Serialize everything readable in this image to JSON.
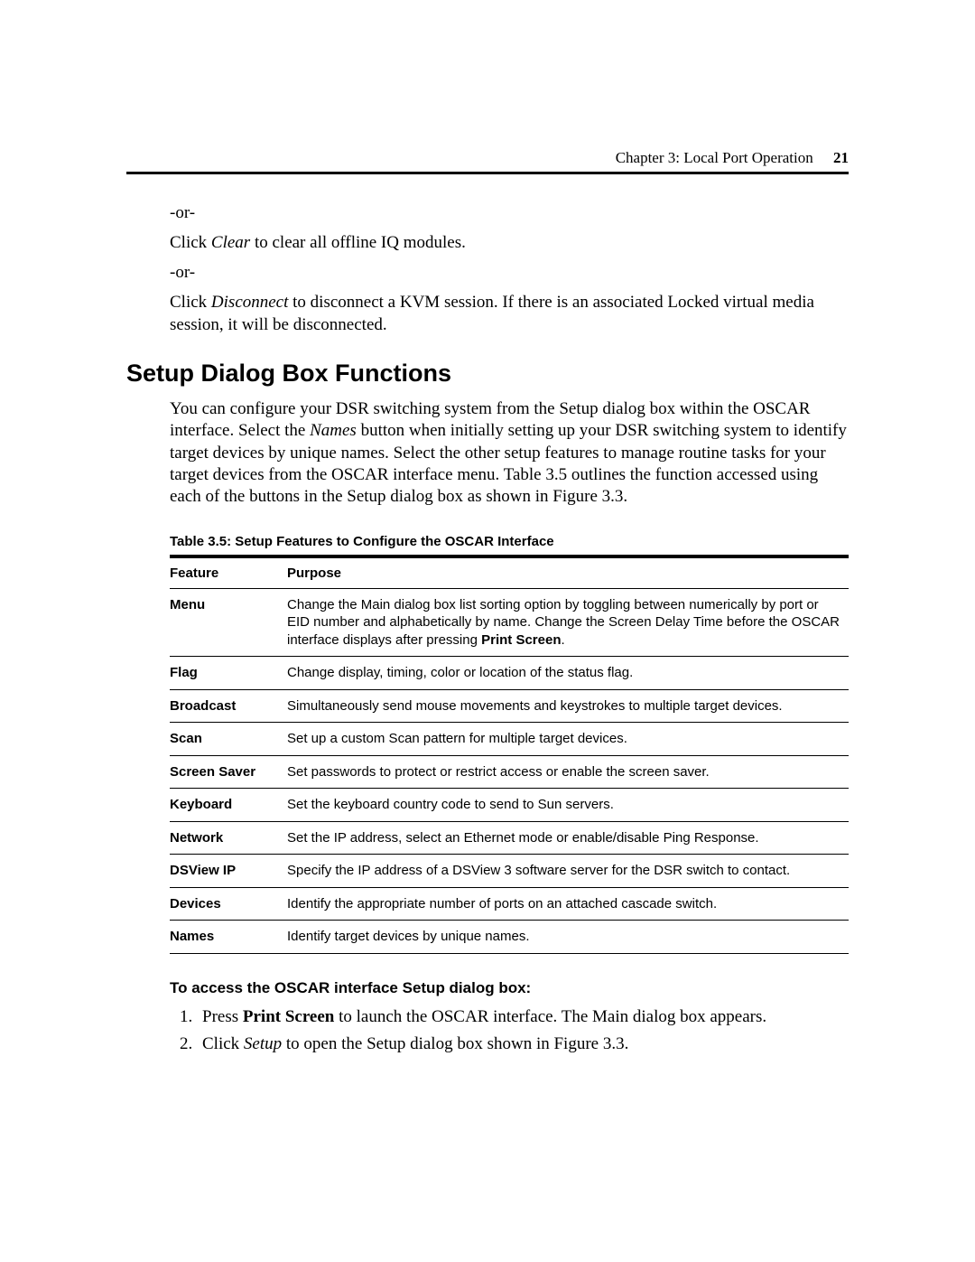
{
  "header": {
    "chapter_label": "Chapter 3: Local Port Operation",
    "page_number": "21"
  },
  "intro": {
    "or1": "-or-",
    "p1_before": "Click ",
    "p1_em": "Clear",
    "p1_after": " to clear all offline IQ modules.",
    "or2": "-or-",
    "p2_before": "Click ",
    "p2_em": "Disconnect",
    "p2_after": " to disconnect a KVM session. If there is an associated Locked virtual media session, it will be disconnected."
  },
  "section_heading": "Setup Dialog Box Functions",
  "section_para": {
    "before": "You can configure your DSR switching system from the Setup dialog box within the OSCAR interface. Select the ",
    "em": "Names",
    "after": " button when initially setting up your DSR switching system to identify target devices by unique names. Select the other setup features to manage routine tasks for your target devices from the OSCAR interface menu. Table 3.5 outlines the function accessed using each of the buttons in the Setup dialog box as shown in Figure 3.3."
  },
  "table": {
    "caption": "Table 3.5: Setup Features to Configure the OSCAR Interface",
    "col_feature": "Feature",
    "col_purpose": "Purpose",
    "rows": [
      {
        "feature": "Menu",
        "purpose_before": "Change the Main dialog box list sorting option by toggling between numerically by port or EID number and alphabetically by name. Change the Screen Delay Time before the OSCAR interface displays after pressing ",
        "purpose_bold": "Print Screen",
        "purpose_after": "."
      },
      {
        "feature": "Flag",
        "purpose": "Change display, timing, color or location of the status flag."
      },
      {
        "feature": "Broadcast",
        "purpose": "Simultaneously send mouse movements and keystrokes to multiple target devices."
      },
      {
        "feature": "Scan",
        "purpose": "Set up a custom Scan pattern for multiple target devices."
      },
      {
        "feature": "Screen Saver",
        "purpose": "Set passwords to protect or restrict access or enable the screen saver."
      },
      {
        "feature": "Keyboard",
        "purpose": "Set the keyboard country code to send to Sun servers."
      },
      {
        "feature": "Network",
        "purpose": "Set the IP address, select an Ethernet mode or enable/disable Ping Response."
      },
      {
        "feature": "DSView IP",
        "purpose": "Specify the IP address of a DSView 3 software server for the DSR switch to contact."
      },
      {
        "feature": "Devices",
        "purpose": "Identify the appropriate number of ports on an attached cascade switch."
      },
      {
        "feature": "Names",
        "purpose": "Identify target devices by unique names."
      }
    ]
  },
  "subhead": "To access the OSCAR interface Setup dialog box:",
  "steps": {
    "s1_before": "Press ",
    "s1_bold": "Print Screen",
    "s1_after": " to launch the OSCAR interface. The Main dialog box appears.",
    "s2_before": "Click ",
    "s2_em": "Setup",
    "s2_after": " to open the Setup dialog box shown in Figure 3.3."
  }
}
